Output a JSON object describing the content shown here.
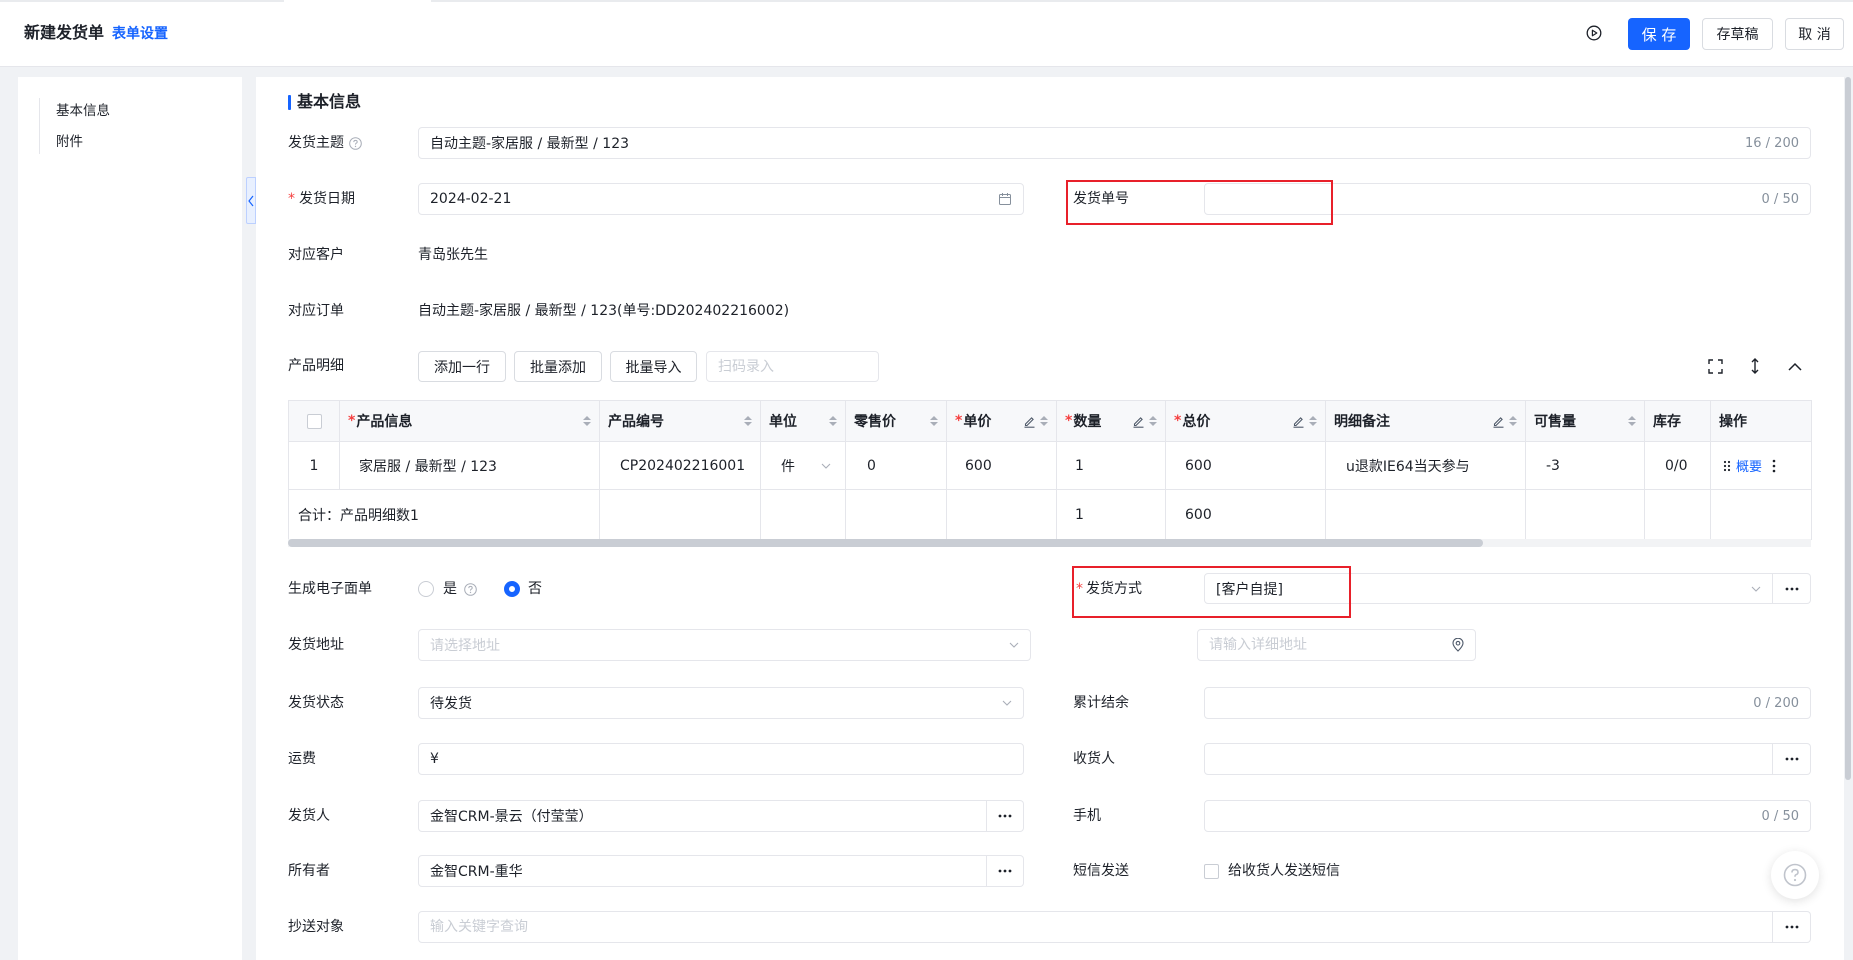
{
  "header": {
    "title": "新建发货单",
    "settings_link": "表单设置",
    "save_label": "保 存",
    "draft_label": "存草稿",
    "cancel_label": "取 消"
  },
  "sidebar": {
    "items": [
      {
        "label": "基本信息"
      },
      {
        "label": "附件"
      }
    ]
  },
  "section_title": "基本信息",
  "form": {
    "subject": {
      "label": "发货主题",
      "value": "自动主题-家居服 / 最新型 / 123",
      "counter": "16 / 200"
    },
    "date": {
      "label": "发货日期",
      "value": "2024-02-21",
      "required": true
    },
    "number": {
      "label": "发货单号",
      "value": "",
      "counter": "0 / 50"
    },
    "customer": {
      "label": "对应客户",
      "value": "青岛张先生"
    },
    "order": {
      "label": "对应订单",
      "value": "自动主题-家居服 / 最新型 / 123(单号:DD202402216002)"
    },
    "e_waybill": {
      "label": "生成电子面单",
      "options": [
        "是",
        "否"
      ],
      "selected": "否"
    },
    "method": {
      "label": "发货方式",
      "value": "[客户自提]",
      "required": true
    },
    "address": {
      "label": "发货地址",
      "placeholder": "请选择地址",
      "detail_placeholder": "请输入详细地址"
    },
    "status": {
      "label": "发货状态",
      "value": "待发货"
    },
    "balance": {
      "label": "累计结余",
      "value": "",
      "counter": "0 / 200"
    },
    "freight": {
      "label": "运费",
      "prefix": "¥",
      "value": ""
    },
    "receiver": {
      "label": "收货人",
      "value": ""
    },
    "shipper": {
      "label": "发货人",
      "value": "金智CRM-景云（付莹莹）"
    },
    "phone": {
      "label": "手机",
      "value": "",
      "counter": "0 / 50"
    },
    "owner": {
      "label": "所有者",
      "value": "金智CRM-重华"
    },
    "sms": {
      "label": "短信发送",
      "checkbox_label": "给收货人发送短信",
      "checked": false
    },
    "cc": {
      "label": "抄送对象",
      "placeholder": "输入关键字查询"
    }
  },
  "products": {
    "label": "产品明细",
    "add_row": "添加一行",
    "batch_add": "批量添加",
    "batch_import": "批量导入",
    "scan_placeholder": "扫码录入",
    "columns": [
      {
        "label": "产品信息",
        "required": true,
        "sortable": true,
        "editable": false
      },
      {
        "label": "产品编号",
        "required": false,
        "sortable": true,
        "editable": false
      },
      {
        "label": "单位",
        "required": false,
        "sortable": true,
        "editable": false
      },
      {
        "label": "零售价",
        "required": false,
        "sortable": true,
        "editable": false
      },
      {
        "label": "单价",
        "required": true,
        "sortable": true,
        "editable": true
      },
      {
        "label": "数量",
        "required": true,
        "sortable": true,
        "editable": true
      },
      {
        "label": "总价",
        "required": true,
        "sortable": true,
        "editable": true
      },
      {
        "label": "明细备注",
        "required": false,
        "sortable": true,
        "editable": true
      },
      {
        "label": "可售量",
        "required": false,
        "sortable": true,
        "editable": false
      },
      {
        "label": "库存",
        "required": false,
        "sortable": false,
        "editable": false
      },
      {
        "label": "操作",
        "required": false,
        "sortable": false,
        "editable": false
      }
    ],
    "rows": [
      {
        "index": "1",
        "product": "家居服 / 最新型 / 123",
        "code": "CP202402216001",
        "unit": "件",
        "retail_price": "0",
        "price": "600",
        "quantity": "1",
        "total": "600",
        "remark": "u退款IE64当天参与",
        "available": "-3",
        "stock": "0/0",
        "action": "概要"
      }
    ],
    "total": {
      "label": "合计：产品明细数1",
      "quantity": "1",
      "total": "600"
    }
  },
  "colors": {
    "primary": "#1664ff",
    "required": "#f53f3f",
    "highlight": "#e8202a"
  }
}
